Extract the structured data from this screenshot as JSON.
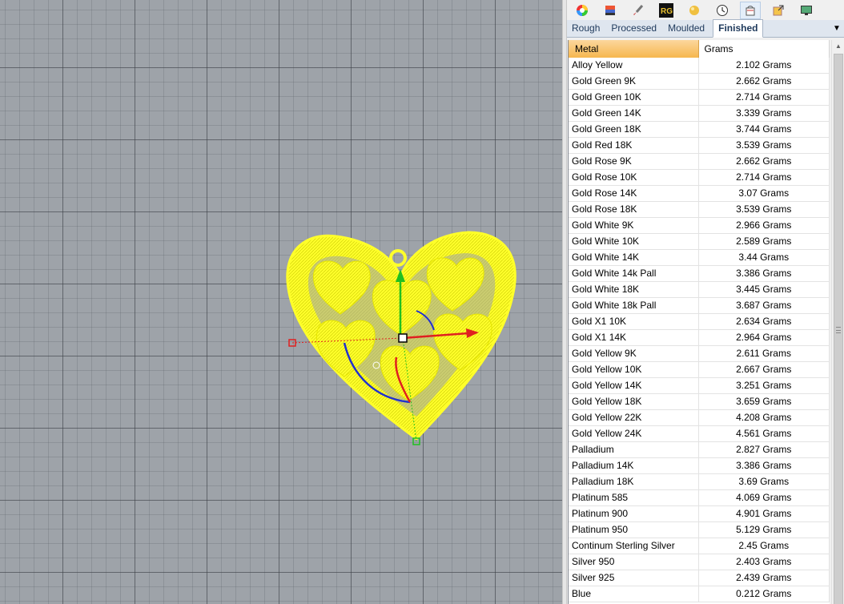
{
  "viewport": {
    "background_color": "#9ea3a9",
    "model_color": "#ffff2a",
    "gumball": {
      "x_axis_color": "#e02020",
      "y_axis_color": "#20c020",
      "z_axis_color": "#2030d0"
    }
  },
  "toolbar": {
    "icons": [
      "color-wheel-icon",
      "layers-icon",
      "brush-icon",
      "rg-logo-icon",
      "gem-icon",
      "clock-icon",
      "basket-icon",
      "export-icon",
      "display-icon"
    ],
    "rg_label": "RG"
  },
  "tabs": [
    {
      "label": "Rough",
      "selected": false
    },
    {
      "label": "Processed",
      "selected": false
    },
    {
      "label": "Moulded",
      "selected": false
    },
    {
      "label": "Finished",
      "selected": true
    }
  ],
  "table": {
    "columns": [
      "Metal",
      "Grams"
    ],
    "rows": [
      {
        "metal": "Alloy Yellow",
        "grams": "2.102 Grams"
      },
      {
        "metal": "Gold Green 9K",
        "grams": "2.662 Grams"
      },
      {
        "metal": "Gold Green 10K",
        "grams": "2.714 Grams"
      },
      {
        "metal": "Gold Green 14K",
        "grams": "3.339 Grams"
      },
      {
        "metal": "Gold Green 18K",
        "grams": "3.744 Grams"
      },
      {
        "metal": "Gold Red 18K",
        "grams": "3.539 Grams"
      },
      {
        "metal": "Gold Rose 9K",
        "grams": "2.662 Grams"
      },
      {
        "metal": "Gold Rose 10K",
        "grams": "2.714 Grams"
      },
      {
        "metal": "Gold Rose 14K",
        "grams": "3.07 Grams"
      },
      {
        "metal": "Gold Rose 18K",
        "grams": "3.539 Grams"
      },
      {
        "metal": "Gold White 9K",
        "grams": "2.966 Grams"
      },
      {
        "metal": "Gold White 10K",
        "grams": "2.589 Grams"
      },
      {
        "metal": "Gold White 14K",
        "grams": "3.44 Grams"
      },
      {
        "metal": "Gold White 14k Pall",
        "grams": "3.386 Grams"
      },
      {
        "metal": "Gold White 18K",
        "grams": "3.445 Grams"
      },
      {
        "metal": "Gold White 18k Pall",
        "grams": "3.687 Grams"
      },
      {
        "metal": "Gold X1 10K",
        "grams": "2.634 Grams"
      },
      {
        "metal": "Gold X1 14K",
        "grams": "2.964 Grams"
      },
      {
        "metal": "Gold Yellow 9K",
        "grams": "2.611 Grams"
      },
      {
        "metal": "Gold Yellow 10K",
        "grams": "2.667 Grams"
      },
      {
        "metal": "Gold Yellow 14K",
        "grams": "3.251 Grams"
      },
      {
        "metal": "Gold Yellow 18K",
        "grams": "3.659 Grams"
      },
      {
        "metal": "Gold Yellow 22K",
        "grams": "4.208 Grams"
      },
      {
        "metal": "Gold Yellow 24K",
        "grams": "4.561 Grams"
      },
      {
        "metal": "Palladium",
        "grams": "2.827 Grams"
      },
      {
        "metal": "Palladium 14K",
        "grams": "3.386 Grams"
      },
      {
        "metal": "Palladium 18K",
        "grams": "3.69 Grams"
      },
      {
        "metal": "Platinum 585",
        "grams": "4.069 Grams"
      },
      {
        "metal": "Platinum 900",
        "grams": "4.901 Grams"
      },
      {
        "metal": "Platinum 950",
        "grams": "5.129 Grams"
      },
      {
        "metal": "Continum Sterling Silver",
        "grams": "2.45 Grams"
      },
      {
        "metal": "Silver 950",
        "grams": "2.403 Grams"
      },
      {
        "metal": "Silver 925",
        "grams": "2.439 Grams"
      },
      {
        "metal": "Blue",
        "grams": "0.212 Grams"
      }
    ]
  }
}
